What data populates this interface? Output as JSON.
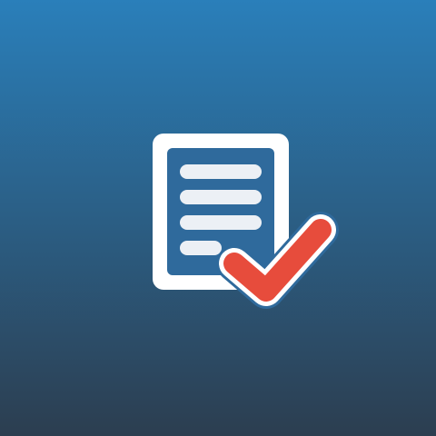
{
  "background": {
    "gradient_top": "#2a7fba",
    "gradient_bottom": "#2c3e50"
  },
  "icon": {
    "name": "checklist-document-icon",
    "document_color": "#ffffff",
    "lines_color": "#ecf0f5",
    "check_color": "#e74c3c"
  }
}
